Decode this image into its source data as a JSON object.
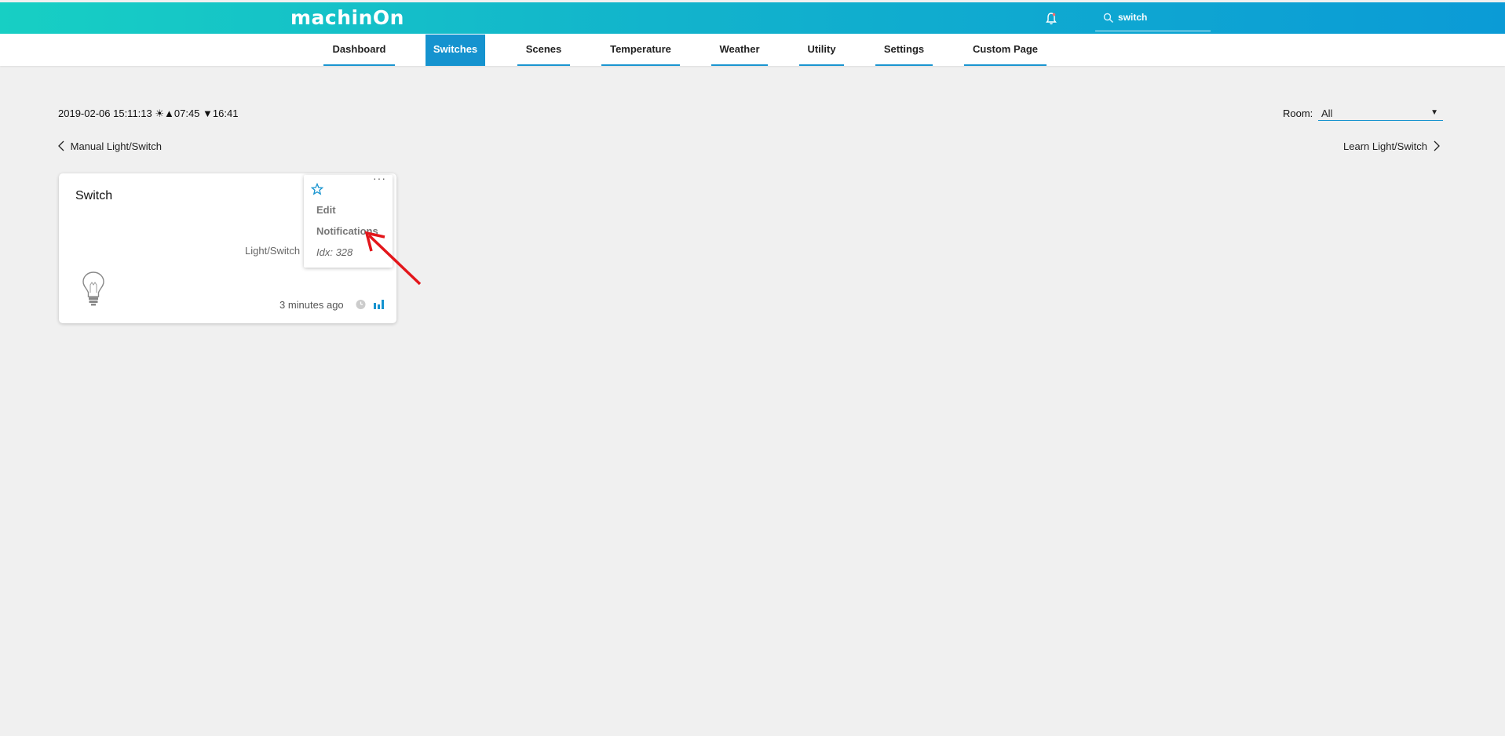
{
  "app": {
    "logo": "machinOn"
  },
  "search": {
    "value": "switch"
  },
  "nav": {
    "tabs": [
      {
        "label": "Dashboard"
      },
      {
        "label": "Switches"
      },
      {
        "label": "Scenes"
      },
      {
        "label": "Temperature"
      },
      {
        "label": "Weather"
      },
      {
        "label": "Utility"
      },
      {
        "label": "Settings"
      },
      {
        "label": "Custom Page"
      }
    ],
    "active": "Switches"
  },
  "status": {
    "datetime": "2019-02-06 15:11:13 ☀▲07:45 ▼16:41"
  },
  "room": {
    "label": "Room:",
    "selected": "All"
  },
  "links": {
    "prev": "Manual Light/Switch",
    "next": "Learn Light/Switch"
  },
  "device": {
    "name": "Switch",
    "type": "Light/Switch",
    "last_update": "3 minutes ago",
    "menu": {
      "edit": "Edit",
      "notifications": "Notifications",
      "idx": "Idx: 328"
    }
  },
  "colors": {
    "accent": "#1593cf",
    "header_start": "#17cfc4",
    "header_end": "#0b9bd6",
    "annotation_arrow": "#e3161b"
  }
}
